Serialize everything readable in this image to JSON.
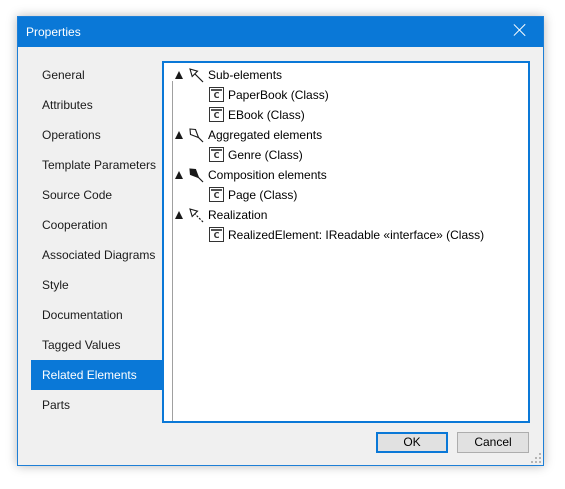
{
  "window": {
    "title": "Properties"
  },
  "nav": {
    "items": [
      {
        "label": "General"
      },
      {
        "label": "Attributes"
      },
      {
        "label": "Operations"
      },
      {
        "label": "Template Parameters"
      },
      {
        "label": "Source Code"
      },
      {
        "label": "Cooperation"
      },
      {
        "label": "Associated Diagrams"
      },
      {
        "label": "Style"
      },
      {
        "label": "Documentation"
      },
      {
        "label": "Tagged Values"
      },
      {
        "label": "Related Elements",
        "selected": true
      },
      {
        "label": "Parts"
      }
    ]
  },
  "tree": {
    "groups": [
      {
        "label": "Sub-elements",
        "icon": "generalization-arrow-icon",
        "children": [
          {
            "label": "PaperBook (Class)"
          },
          {
            "label": "EBook (Class)"
          }
        ]
      },
      {
        "label": "Aggregated elements",
        "icon": "aggregation-diamond-icon",
        "children": [
          {
            "label": "Genre (Class)"
          }
        ]
      },
      {
        "label": "Composition elements",
        "icon": "composition-diamond-icon",
        "children": [
          {
            "label": "Page (Class)"
          }
        ]
      },
      {
        "label": "Realization",
        "icon": "realization-arrow-icon",
        "children": [
          {
            "label": "RealizedElement: IReadable «interface» (Class)"
          }
        ]
      }
    ],
    "class_icon_letter": "C"
  },
  "buttons": {
    "ok": "OK",
    "cancel": "Cancel"
  },
  "colors": {
    "accent": "#0a78d7",
    "window_bg": "#f0f0f0"
  }
}
